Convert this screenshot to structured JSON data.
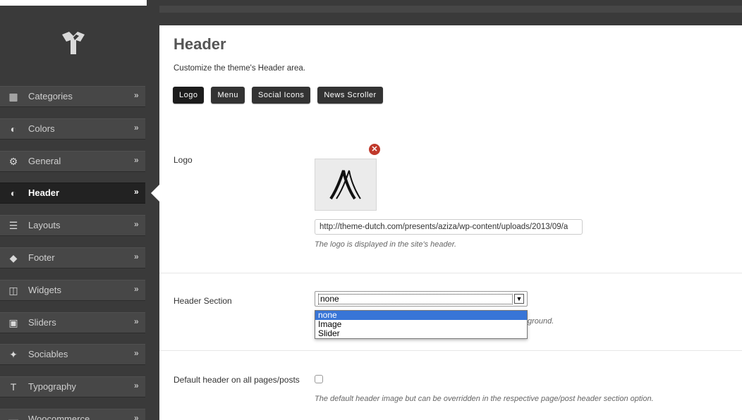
{
  "sidebar": {
    "items": [
      {
        "label": "Categories",
        "icon": "grid-icon",
        "glyph": "▦",
        "active": false
      },
      {
        "label": "Colors",
        "icon": "half-circle-icon",
        "glyph": "◐",
        "active": false
      },
      {
        "label": "General",
        "icon": "gears-icon",
        "glyph": "⚙",
        "active": false
      },
      {
        "label": "Header",
        "icon": "half-circle-icon",
        "glyph": "◐",
        "active": true
      },
      {
        "label": "Layouts",
        "icon": "list-icon",
        "glyph": "☰",
        "active": false
      },
      {
        "label": "Footer",
        "icon": "tag-icon",
        "glyph": "◆",
        "active": false
      },
      {
        "label": "Widgets",
        "icon": "columns-icon",
        "glyph": "◫",
        "active": false
      },
      {
        "label": "Sliders",
        "icon": "image-icon",
        "glyph": "▣",
        "active": false
      },
      {
        "label": "Sociables",
        "icon": "twitter-bird-icon",
        "glyph": "✦",
        "active": false
      },
      {
        "label": "Typography",
        "icon": "text-icon",
        "glyph": "T",
        "active": false
      },
      {
        "label": "Woocommerce",
        "icon": "cart-icon",
        "glyph": "▬",
        "active": false
      }
    ],
    "arrow": "»"
  },
  "main": {
    "title": "Header",
    "description": "Customize the theme's Header area.",
    "tabs": [
      "Logo",
      "Menu",
      "Social Icons",
      "News Scroller"
    ],
    "logo": {
      "label": "Logo",
      "url_value": "http://theme-dutch.com/presents/aziza/wp-content/uploads/2013/09/a",
      "hint": "The logo is displayed in the site's header.",
      "remove_glyph": "✕"
    },
    "header_section": {
      "label": "Header Section",
      "selected": "none",
      "options": [
        "none",
        "Image",
        "Slider"
      ],
      "hint_visible": "ground."
    },
    "default_header": {
      "label": "Default header on all pages/posts",
      "checked": false,
      "hint": "The default header image but can be overridden in the respective page/post header section option."
    }
  },
  "colors": {
    "sidebar_bg": "#3a3a3a",
    "active_item": "#222222",
    "tab_bg": "#333333",
    "dropdown_selected": "#3875d7",
    "remove_badge": "#c0392b"
  }
}
